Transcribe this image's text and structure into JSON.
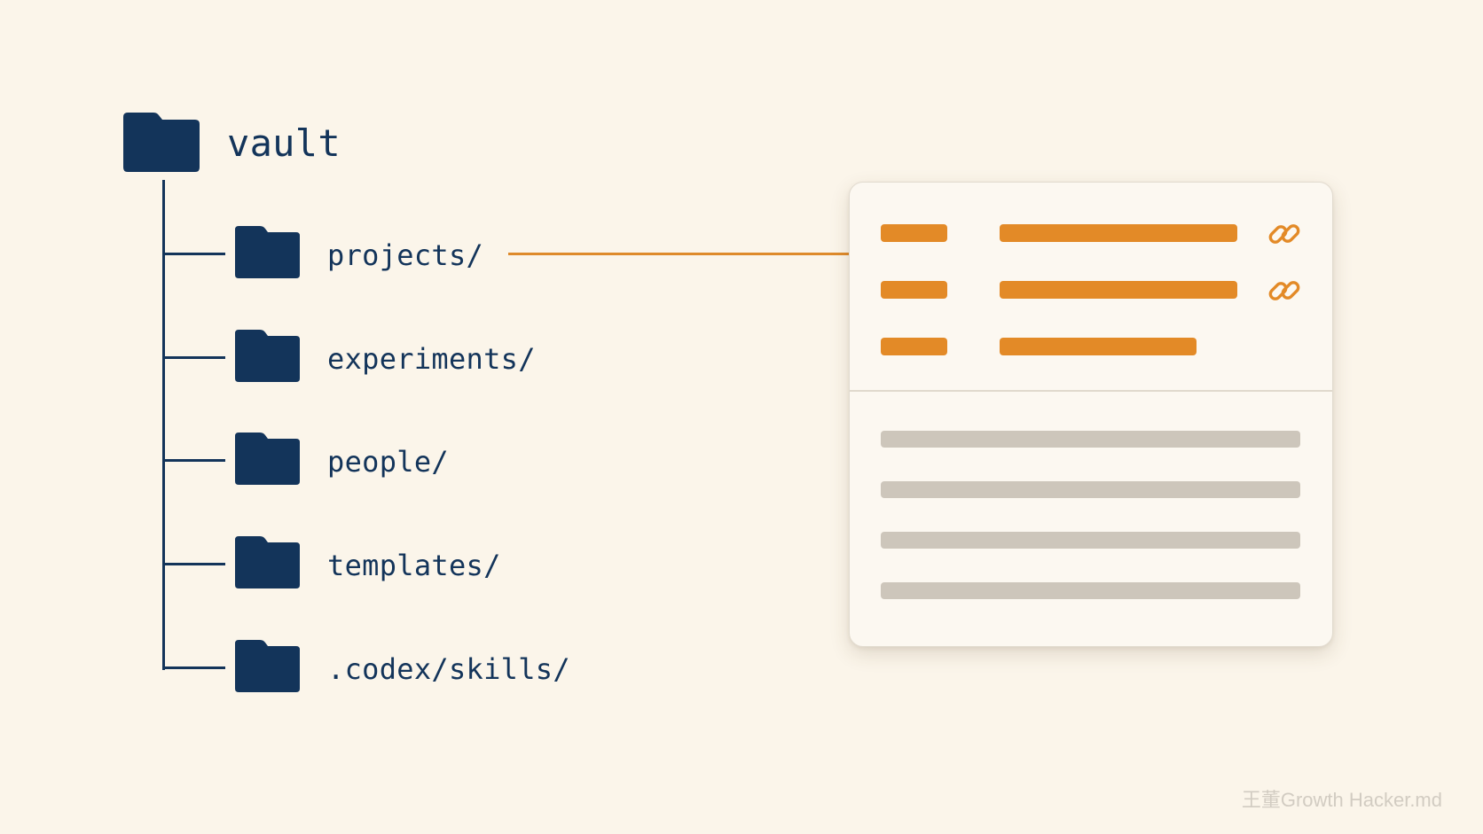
{
  "tree": {
    "root": {
      "label": "vault",
      "icon": "folder-icon"
    },
    "children": [
      {
        "label": "projects/",
        "icon": "folder-icon",
        "linked": true
      },
      {
        "label": "experiments/",
        "icon": "folder-icon"
      },
      {
        "label": "people/",
        "icon": "folder-icon"
      },
      {
        "label": "templates/",
        "icon": "folder-icon"
      },
      {
        "label": ".codex/skills/",
        "icon": "folder-icon"
      }
    ]
  },
  "note_card": {
    "properties": [
      {
        "link_icon": "link-icon"
      },
      {
        "link_icon": "link-icon"
      },
      {
        "link_icon": null
      }
    ],
    "body_lines": 4
  },
  "watermark": "王董Growth Hacker.md",
  "colors": {
    "background": "#fbf5ea",
    "ink": "#13345a",
    "accent": "#e38a27",
    "placeholder": "#cdc6bb",
    "card": "#fcf8f1"
  }
}
